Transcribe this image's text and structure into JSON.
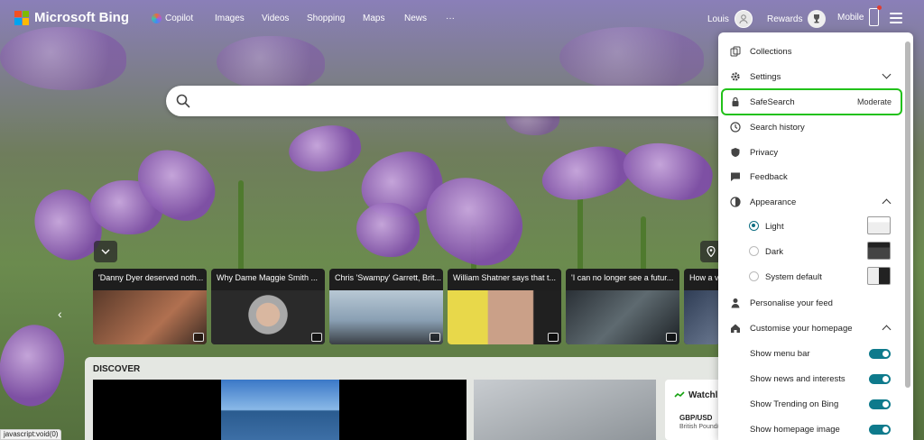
{
  "brand": {
    "name": "Microsoft Bing",
    "logo_colors": [
      "#f25022",
      "#7fba00",
      "#00a4ef",
      "#ffb900"
    ]
  },
  "nav": [
    {
      "label": "Copilot",
      "icon": "copilot-icon"
    },
    {
      "label": "Images"
    },
    {
      "label": "Videos"
    },
    {
      "label": "Shopping"
    },
    {
      "label": "Maps"
    },
    {
      "label": "News"
    },
    {
      "label": "···"
    }
  ],
  "user": {
    "name": "Louis"
  },
  "rewards": {
    "label": "Rewards"
  },
  "mobile": {
    "label": "Mobile"
  },
  "search": {
    "placeholder": ""
  },
  "news_cards": [
    {
      "title": "'Danny Dyer deserved noth..."
    },
    {
      "title": "Why Dame Maggie Smith ..."
    },
    {
      "title": "Chris 'Swampy' Garrett, Brit..."
    },
    {
      "title": "William Shatner says that t..."
    },
    {
      "title": "'I can no longer see a futur..."
    },
    {
      "title": "How a v"
    }
  ],
  "discover": {
    "title": "DISCOVER"
  },
  "watchlist": {
    "title": "Watchli",
    "item": "GBP/USD",
    "item_sub": "British Pound/"
  },
  "status_bar": "javascript:void(0)",
  "settings_panel": {
    "collections": "Collections",
    "settings": "Settings",
    "safesearch": {
      "label": "SafeSearch",
      "value": "Moderate",
      "highlight_color": "#22c11a"
    },
    "search_history": "Search history",
    "privacy": "Privacy",
    "feedback": "Feedback",
    "appearance": "Appearance",
    "themes": [
      {
        "label": "Light",
        "selected": true
      },
      {
        "label": "Dark",
        "selected": false
      },
      {
        "label": "System default",
        "selected": false
      }
    ],
    "personalise": "Personalise your feed",
    "customise": "Customise your homepage",
    "toggles": [
      {
        "label": "Show menu bar",
        "on": true
      },
      {
        "label": "Show news and interests",
        "on": true
      },
      {
        "label": "Show Trending on Bing",
        "on": true
      },
      {
        "label": "Show homepage image",
        "on": true
      }
    ],
    "toggle_color": "#0e7a8c"
  }
}
